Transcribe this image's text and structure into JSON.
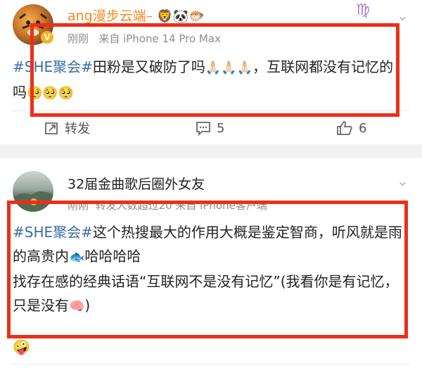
{
  "post1": {
    "username": "ang漫步云端–",
    "name_emojis": "🦁🐼🐡",
    "time": "刚刚",
    "source": "来自 iPhone 14 Pro Max",
    "hashtag": "#SHE聚会#",
    "text_part1": "田粉是又破防了吗",
    "text_emoji1": "🙏🏻🙏🏻🙏🏻",
    "text_part2": "，互联网都没有记忆的吗",
    "text_emoji2": "🥺🥺🥺",
    "repost_label": "转发",
    "comment_count": "5",
    "like_count": "6",
    "decor_sign": "♍"
  },
  "post2": {
    "username": "32届金曲歌后圈外女友",
    "time": "刚刚",
    "meta_rest": "转发人数超过20  来自 iPhone客户端",
    "hashtag": "#SHE聚会#",
    "line1_text": "这个热搜最大的作用大概是鉴定智商，听风就是雨的高贵内",
    "fish_emoji": "🐟",
    "line1_end": "哈哈哈哈",
    "line2_text": "找存在感的经典话语“互联网不是没有记忆”(我看你是有记忆，只是没有",
    "brain_emoji": "🧠",
    "line2_end": ")",
    "reaction_emoji": "🤪"
  },
  "colors": {
    "accent_red": "#ee2e18",
    "hashtag_blue": "#3a6ea5",
    "username_orange": "#f08a24",
    "meta_gray": "#8c8c8c"
  },
  "icons": {
    "repost": "repost-icon",
    "comment": "comment-icon",
    "like": "thumbs-up-icon",
    "more": "chevron-down-icon"
  }
}
